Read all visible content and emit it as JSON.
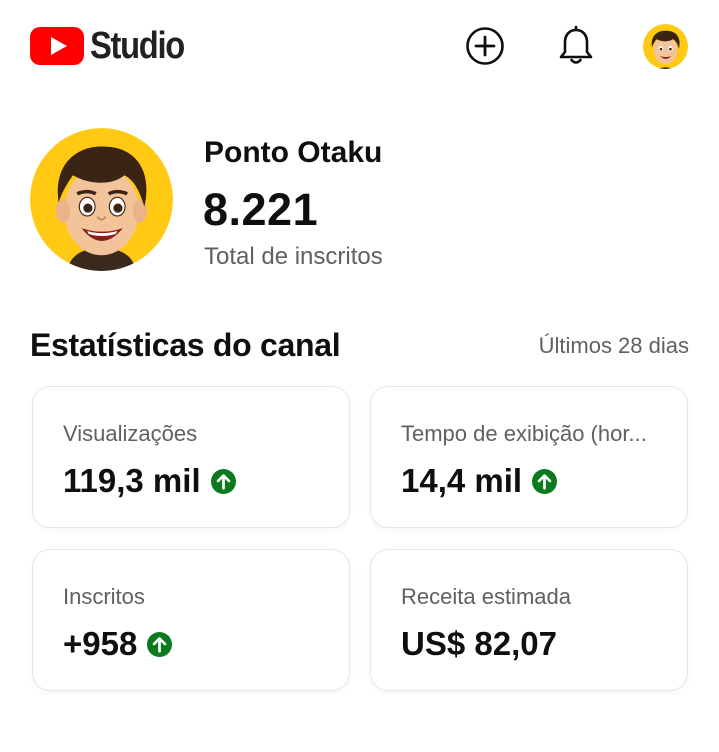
{
  "header": {
    "logo_text": "Studio",
    "icons": [
      "youtube-logo-icon",
      "create-plus-icon",
      "bell-icon",
      "avatar"
    ]
  },
  "channel": {
    "name": "Ponto Otaku",
    "subscriber_count": "8.221",
    "subscriber_label": "Total de inscritos"
  },
  "stats": {
    "title": "Estatísticas do canal",
    "period": "Últimos 28 dias",
    "cards": [
      {
        "label": "Visualizações",
        "value": "119,3 mil",
        "trend": "up"
      },
      {
        "label": "Tempo de exibição (hor...",
        "value": "14,4 mil",
        "trend": "up"
      },
      {
        "label": "Inscritos",
        "value": "+958",
        "trend": "up"
      },
      {
        "label": "Receita estimada",
        "value": "US$ 82,07",
        "trend": "none"
      }
    ]
  },
  "colors": {
    "brand_red": "#ff0000",
    "trend_green": "#0b7a1f",
    "avatar_bg": "#ffc914",
    "secondary_text": "#606060"
  }
}
